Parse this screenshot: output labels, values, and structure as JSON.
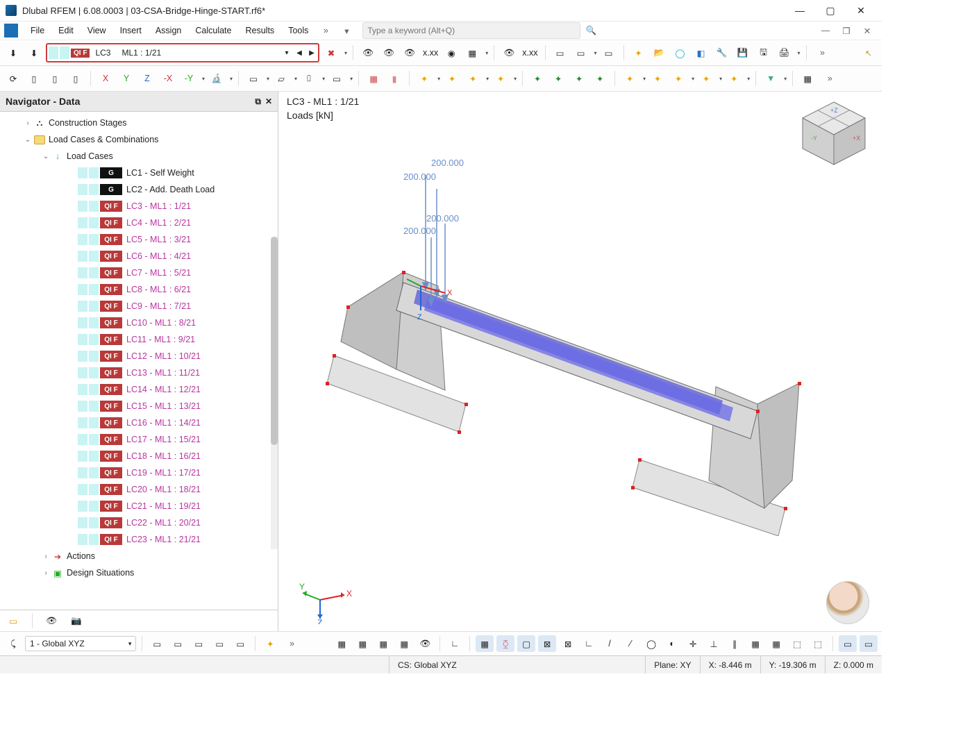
{
  "title": "Dlubal RFEM | 6.08.0003 | 03-CSA-Bridge-Hinge-START.rf6*",
  "menu": [
    "File",
    "Edit",
    "View",
    "Insert",
    "Assign",
    "Calculate",
    "Results",
    "Tools"
  ],
  "search_placeholder": "Type a keyword (Alt+Q)",
  "lc_combo": {
    "tag": "QI F",
    "code": "LC3",
    "text": "ML1 : 1/21"
  },
  "navigator": {
    "title": "Navigator - Data",
    "nodes": {
      "constr": "Construction Stages",
      "lcc": "Load Cases & Combinations",
      "lc": "Load Cases",
      "actions": "Actions",
      "ds": "Design Situations"
    }
  },
  "load_cases_g": [
    {
      "tag": "G",
      "label": "LC1 - Self Weight"
    },
    {
      "tag": "G",
      "label": "LC2 - Add. Death Load"
    }
  ],
  "load_cases": [
    "LC3 - ML1 : 1/21",
    "LC4 - ML1 : 2/21",
    "LC5 - ML1 : 3/21",
    "LC6 - ML1 : 4/21",
    "LC7 - ML1 : 5/21",
    "LC8 - ML1 : 6/21",
    "LC9 - ML1 : 7/21",
    "LC10 - ML1 : 8/21",
    "LC11 - ML1 : 9/21",
    "LC12 - ML1 : 10/21",
    "LC13 - ML1 : 11/21",
    "LC14 - ML1 : 12/21",
    "LC15 - ML1 : 13/21",
    "LC16 - ML1 : 14/21",
    "LC17 - ML1 : 15/21",
    "LC18 - ML1 : 16/21",
    "LC19 - ML1 : 17/21",
    "LC20 - ML1 : 18/21",
    "LC21 - ML1 : 19/21",
    "LC22 - ML1 : 20/21",
    "LC23 - ML1 : 21/21"
  ],
  "viewport": {
    "title": "LC3 - ML1 : 1/21",
    "sub": "Loads [kN]",
    "loads": [
      "200.000",
      "200.000",
      "200.000",
      "200.000"
    ]
  },
  "cs_combo": "1 - Global XYZ",
  "status": {
    "cs": "CS: Global XYZ",
    "plane": "Plane: XY",
    "x": "X: -8.446 m",
    "y": "Y: -19.306 m",
    "z": "Z: 0.000 m"
  },
  "triad": {
    "x": "X",
    "y": "Y",
    "z": "Z"
  }
}
